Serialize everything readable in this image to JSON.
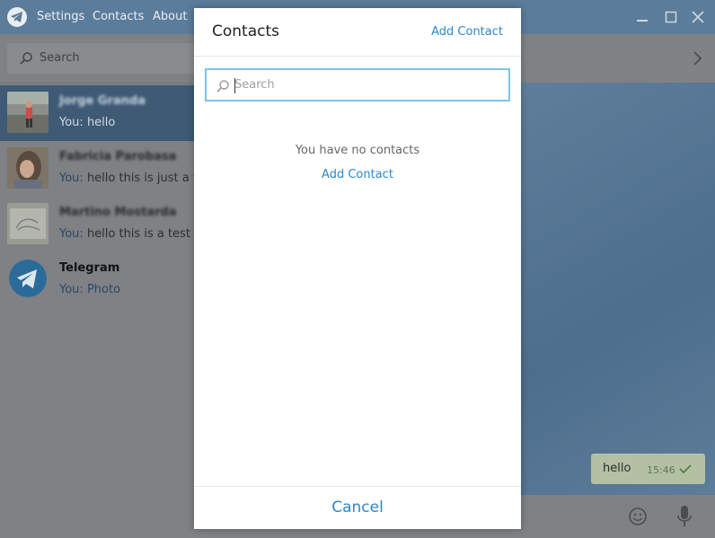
{
  "menu": {
    "settings": "Settings",
    "contacts": "Contacts",
    "about": "About"
  },
  "left": {
    "search_placeholder": "Search",
    "chats": [
      {
        "name": "Jorge Granda",
        "you": "You:",
        "message": "hello"
      },
      {
        "name": "Fabricia Parobasa",
        "you": "You:",
        "message": "hello this is just a test"
      },
      {
        "name": "Martino Mostarda",
        "you": "You:",
        "message": "hello this is a test"
      },
      {
        "name": "Telegram",
        "you": "You:",
        "message": "Photo"
      }
    ]
  },
  "conversation": {
    "bubble_text": "hello",
    "bubble_time": "15:46"
  },
  "modal": {
    "title": "Contacts",
    "add_contact": "Add Contact",
    "search_placeholder": "Search",
    "empty_message": "You have no contacts",
    "empty_add_contact": "Add Contact",
    "cancel": "Cancel"
  },
  "colors": {
    "accent": "#2b87c8",
    "focus_border": "#7fc3ec",
    "titlebar": "#5b7c9b"
  }
}
